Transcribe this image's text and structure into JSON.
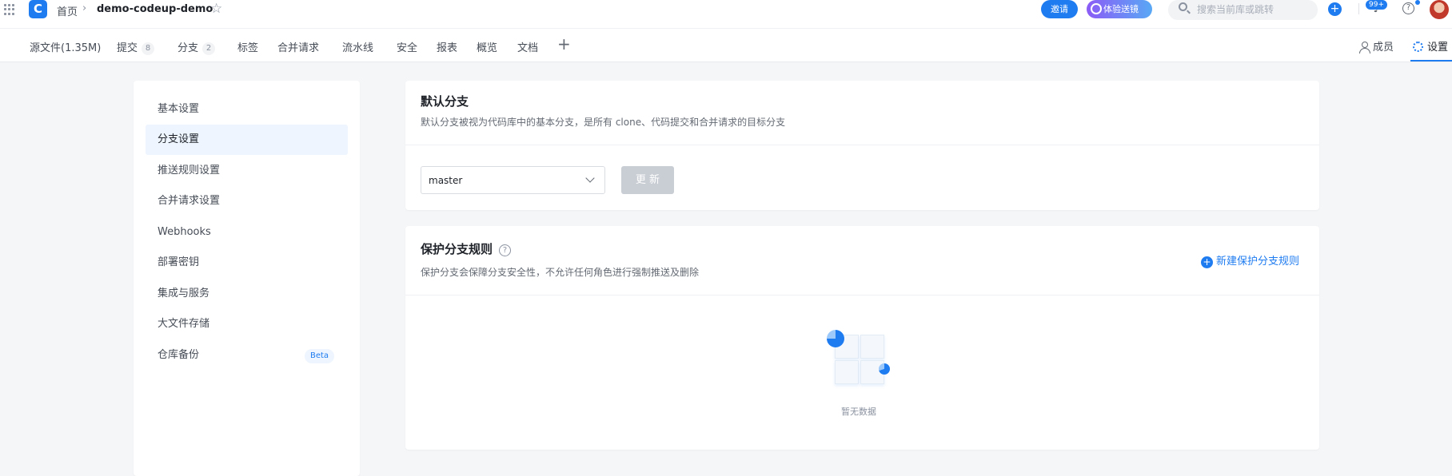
{
  "breadcrumb": {
    "home": "首页",
    "separator": "›",
    "repo": "demo-codeup-demo"
  },
  "header": {
    "invite_label": "邀请",
    "experience_label": "体验送镜",
    "search_placeholder": "搜索当前库或跳转",
    "notification_badge": "99+"
  },
  "tabs": [
    {
      "label": "源文件(1.35M)"
    },
    {
      "label": "提交",
      "count": "8"
    },
    {
      "label": "分支",
      "count": "2"
    },
    {
      "label": "标签"
    },
    {
      "label": "合并请求"
    },
    {
      "label": "流水线"
    },
    {
      "label": "安全"
    },
    {
      "label": "报表"
    },
    {
      "label": "概览"
    },
    {
      "label": "文档"
    }
  ],
  "tabs_right": {
    "members": "成员",
    "settings": "设置"
  },
  "sidebar": {
    "items": [
      {
        "label": "基本设置"
      },
      {
        "label": "分支设置",
        "active": true
      },
      {
        "label": "推送规则设置"
      },
      {
        "label": "合并请求设置"
      },
      {
        "label": "Webhooks"
      },
      {
        "label": "部署密钥"
      },
      {
        "label": "集成与服务"
      },
      {
        "label": "大文件存储"
      },
      {
        "label": "仓库备份",
        "badge": "Beta"
      }
    ]
  },
  "default_branch": {
    "title": "默认分支",
    "description": "默认分支被视为代码库中的基本分支，是所有 clone、代码提交和合并请求的目标分支",
    "selected_branch": "master",
    "update_label": "更 新"
  },
  "protected_branches": {
    "title": "保护分支规则",
    "help_glyph": "?",
    "description": "保护分支会保障分支安全性，不允许任何角色进行强制推送及删除",
    "new_rule_label": "新建保护分支规则",
    "empty_text": "暂无数据"
  },
  "colors": {
    "accent": "#1f7cf0",
    "disabled_button": "#c9cdd4",
    "active_nav_bg": "#eef5fe"
  }
}
